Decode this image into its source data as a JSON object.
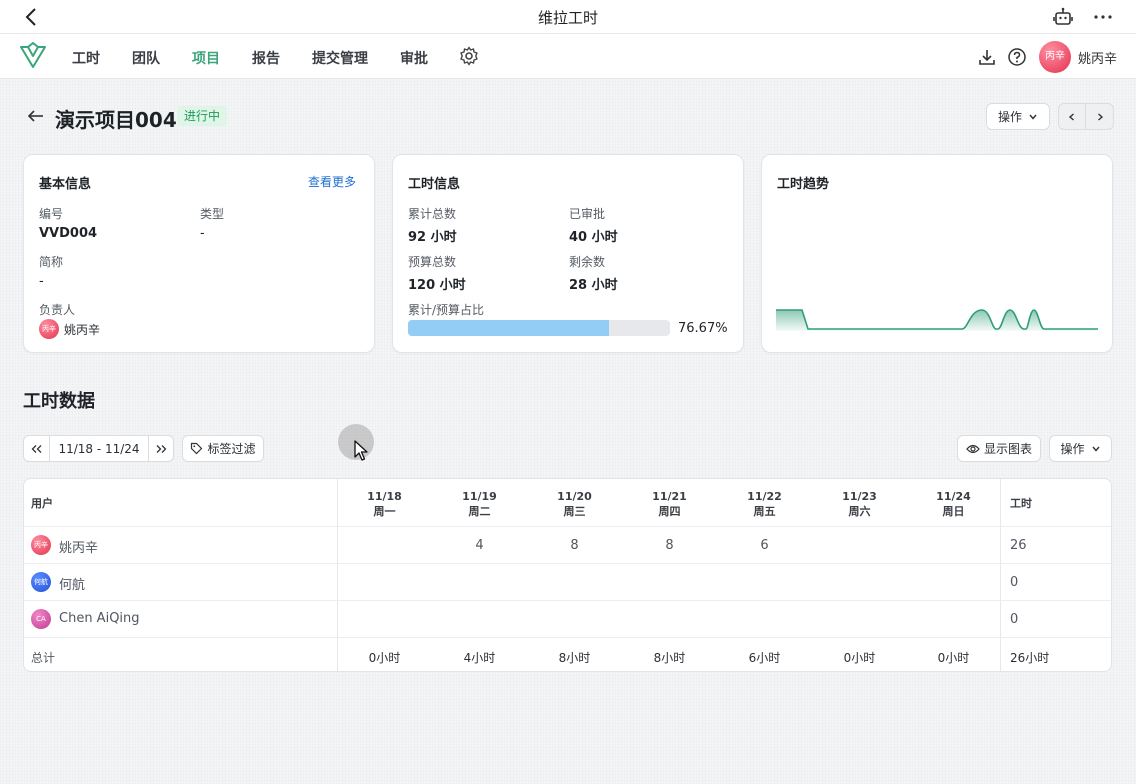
{
  "app": {
    "title": "维拉工时"
  },
  "nav": {
    "items": [
      {
        "label": "工时",
        "active": false
      },
      {
        "label": "团队",
        "active": false
      },
      {
        "label": "项目",
        "active": true
      },
      {
        "label": "报告",
        "active": false
      },
      {
        "label": "提交管理",
        "active": false
      },
      {
        "label": "审批",
        "active": false
      }
    ],
    "user": {
      "name": "姚丙辛",
      "avatar_text": "丙辛"
    },
    "accent": "#3aa57a"
  },
  "project": {
    "title": "演示项目004",
    "status": "进行中",
    "action_label": "操作"
  },
  "basic_info": {
    "title": "基本信息",
    "more_link": "查看更多",
    "code_label": "编号",
    "code_value": "VVD004",
    "type_label": "类型",
    "type_value": "-",
    "short_label": "简称",
    "short_value": "-",
    "owner_label": "负责人",
    "owner_name": "姚丙辛",
    "owner_avatar": "丙辛"
  },
  "hours_info": {
    "title": "工时信息",
    "total_label": "累计总数",
    "total_value": "92 小时",
    "approved_label": "已审批",
    "approved_value": "40 小时",
    "budget_label": "预算总数",
    "budget_value": "120 小时",
    "remaining_label": "剩余数",
    "remaining_value": "28 小时",
    "ratio_label": "累计/预算占比",
    "ratio_value": "76.67%",
    "ratio_fraction": 0.7667
  },
  "trend": {
    "title": "工时趋势",
    "color": "#2e9d78"
  },
  "timesheet": {
    "section_title": "工时数据",
    "date_range": "11/18 - 11/24",
    "tag_filter": "标签过滤",
    "show_chart": "显示图表",
    "action_label": "操作",
    "user_col": "用户",
    "total_col": "工时",
    "days": [
      {
        "date": "11/18",
        "weekday": "周一"
      },
      {
        "date": "11/19",
        "weekday": "周二"
      },
      {
        "date": "11/20",
        "weekday": "周三"
      },
      {
        "date": "11/21",
        "weekday": "周四"
      },
      {
        "date": "11/22",
        "weekday": "周五"
      },
      {
        "date": "11/23",
        "weekday": "周六"
      },
      {
        "date": "11/24",
        "weekday": "周日"
      }
    ],
    "rows": [
      {
        "name": "姚丙辛",
        "avatar": "丙辛",
        "values": [
          "",
          "4",
          "8",
          "8",
          "6",
          "",
          ""
        ],
        "total": "26"
      },
      {
        "name": "何航",
        "avatar": "何航",
        "values": [
          "",
          "",
          "",
          "",
          "",
          "",
          ""
        ],
        "total": "0"
      },
      {
        "name": "Chen AiQing",
        "avatar": "CA",
        "values": [
          "",
          "",
          "",
          "",
          "",
          "",
          ""
        ],
        "total": "0"
      }
    ],
    "totals_label": "总计",
    "totals": [
      "0小时",
      "4小时",
      "8小时",
      "8小时",
      "6小时",
      "0小时",
      "0小时"
    ],
    "grand_total": "26小时"
  }
}
